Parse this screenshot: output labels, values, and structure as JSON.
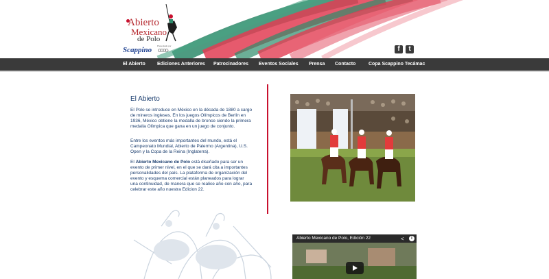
{
  "brand": {
    "logo_line1": "Abierto",
    "logo_line2": "Mexicano",
    "logo_line3": "de Polo",
    "sponsor1": "Scappino",
    "sponsor2_text": "Presentado por"
  },
  "social": {
    "facebook_glyph": "f",
    "twitter_glyph": "t"
  },
  "nav": {
    "items": [
      "El Abierto",
      "Ediciones Anteriores",
      "Patrocinadores",
      "Eventos Sociales",
      "Prensa",
      "Contacto",
      "Copa Scappino Tecámac"
    ]
  },
  "content": {
    "title": "El Abierto",
    "p1": "El Polo se introduce en México en la década de 1880 a cargo de mineros ingleses. En los juegos Olímpicos de Berlín en 1936, México obtiene la medalla de bronce siendo la primera medalla Olímpica que gana en un juego de conjunto.",
    "p2": "Entre los eventos más importantes del mundo, está el Campeonato Mundial, Abierto de Palermo (Argentina), U.S. Open y la Copa de la Reina (Inglaterra).",
    "p3_lead": "El ",
    "p3_bold": "Abierto Mexicano de Polo",
    "p3_rest": " está diseñado para ser un evento de primer nivel, en el que se dará cita a importantes personalidades del país. La plataforma de organización del evento y esquema comercial están planeados para lograr una continuidad, de manera que se realice año con año, para celebrar este año nuestra Edicion 22."
  },
  "video": {
    "title": "Abierto Mexicano de Polo, Edición 22",
    "info_glyph": "i"
  },
  "colors": {
    "accent_red": "#c8102e",
    "accent_green": "#2e8b6b",
    "nav_bg": "#3a3a3a",
    "text_blue": "#1a3d6e"
  },
  "icons": {
    "facebook": "facebook-icon",
    "twitter": "twitter-icon",
    "share": "share-icon",
    "info": "info-icon",
    "play": "play-icon"
  }
}
